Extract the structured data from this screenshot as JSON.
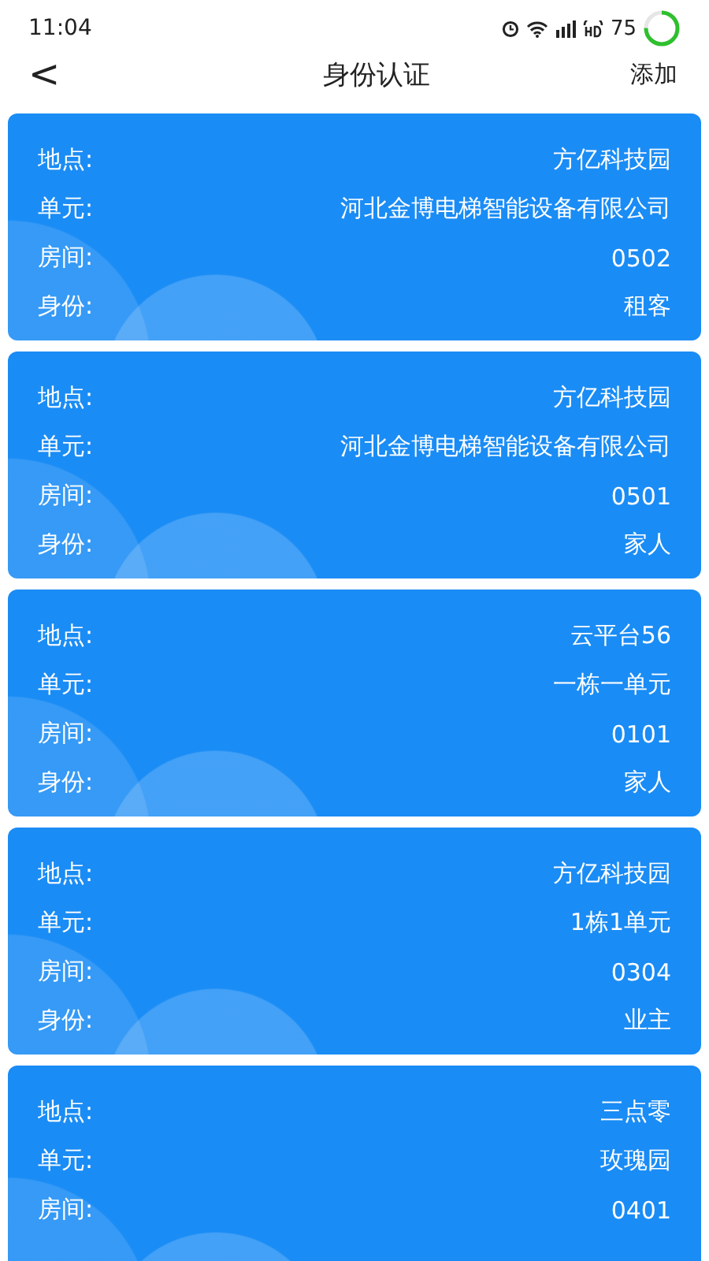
{
  "status_bar": {
    "time": "11:04",
    "battery": "75"
  },
  "header": {
    "back": "<",
    "title": "身份认证",
    "action": "添加"
  },
  "cards": [
    {
      "rows": [
        {
          "label": "地点:",
          "value": "方亿科技园"
        },
        {
          "label": "单元:",
          "value": "河北金博电梯智能设备有限公司"
        },
        {
          "label": "房间:",
          "value": "0502"
        },
        {
          "label": "身份:",
          "value": "租客"
        }
      ]
    },
    {
      "rows": [
        {
          "label": "地点:",
          "value": "方亿科技园"
        },
        {
          "label": "单元:",
          "value": "河北金博电梯智能设备有限公司"
        },
        {
          "label": "房间:",
          "value": "0501"
        },
        {
          "label": "身份:",
          "value": "家人"
        }
      ]
    },
    {
      "rows": [
        {
          "label": "地点:",
          "value": "云平台56"
        },
        {
          "label": "单元:",
          "value": "一栋一单元"
        },
        {
          "label": "房间:",
          "value": "0101"
        },
        {
          "label": "身份:",
          "value": "家人"
        }
      ]
    },
    {
      "rows": [
        {
          "label": "地点:",
          "value": "方亿科技园"
        },
        {
          "label": "单元:",
          "value": "1栋1单元"
        },
        {
          "label": "房间:",
          "value": "0304"
        },
        {
          "label": "身份:",
          "value": "业主"
        }
      ]
    },
    {
      "rows": [
        {
          "label": "地点:",
          "value": "三点零"
        },
        {
          "label": "单元:",
          "value": "玫瑰园"
        },
        {
          "label": "房间:",
          "value": "0401"
        }
      ]
    }
  ]
}
